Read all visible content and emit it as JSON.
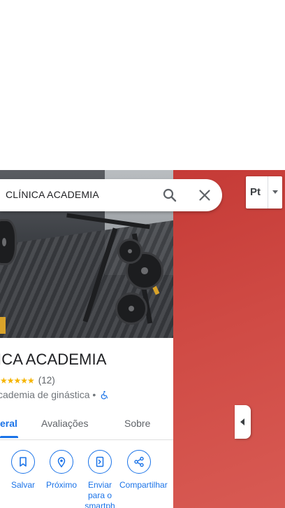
{
  "search": {
    "query": "CLÍNICA ACADEMIA"
  },
  "map_controls": {
    "layer_button_label": "Pt"
  },
  "place": {
    "title": "ICA ACADEMIA",
    "rating_stars": "★★★★★",
    "rating_value": 4.5,
    "review_count": "(12)",
    "category": "cademia de ginástica •"
  },
  "tabs": [
    {
      "label": "eral",
      "active": true
    },
    {
      "label": "Avaliações",
      "active": false
    },
    {
      "label": "Sobre",
      "active": false
    }
  ],
  "actions": [
    {
      "label": "Salvar",
      "icon": "bookmark-icon"
    },
    {
      "label": "Próximo",
      "icon": "nearby-icon"
    },
    {
      "label": "Enviar para o smartph",
      "icon": "send-to-phone-icon"
    },
    {
      "label": "Compartilhar",
      "icon": "share-icon"
    }
  ],
  "colors": {
    "accent": "#1a73e8",
    "star": "#f5b400",
    "map_red": "#cf4a44"
  }
}
